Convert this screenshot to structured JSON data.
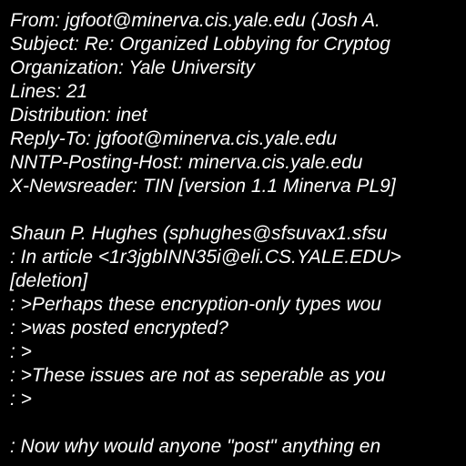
{
  "colors": {
    "background": "#000000",
    "text": "#ffffff"
  },
  "message": {
    "lines": [
      "From: jgfoot@minerva.cis.yale.edu (Josh A.",
      "Subject: Re: Organized Lobbying for Cryptog",
      "Organization: Yale University",
      "Lines: 21",
      "Distribution: inet",
      "Reply-To: jgfoot@minerva.cis.yale.edu",
      "NNTP-Posting-Host: minerva.cis.yale.edu",
      "X-Newsreader: TIN [version 1.1 Minerva PL9]",
      "",
      "Shaun P. Hughes (sphughes@sfsuvax1.sfsu",
      ": In article <1r3jgbINN35i@eli.CS.YALE.EDU>",
      "[deletion]",
      ": >Perhaps these encryption-only types wou",
      ": >was posted encrypted?",
      ": >",
      ": >These issues are not as seperable as you",
      ": >",
      "",
      ": Now why would anyone \"post\" anything en"
    ]
  }
}
